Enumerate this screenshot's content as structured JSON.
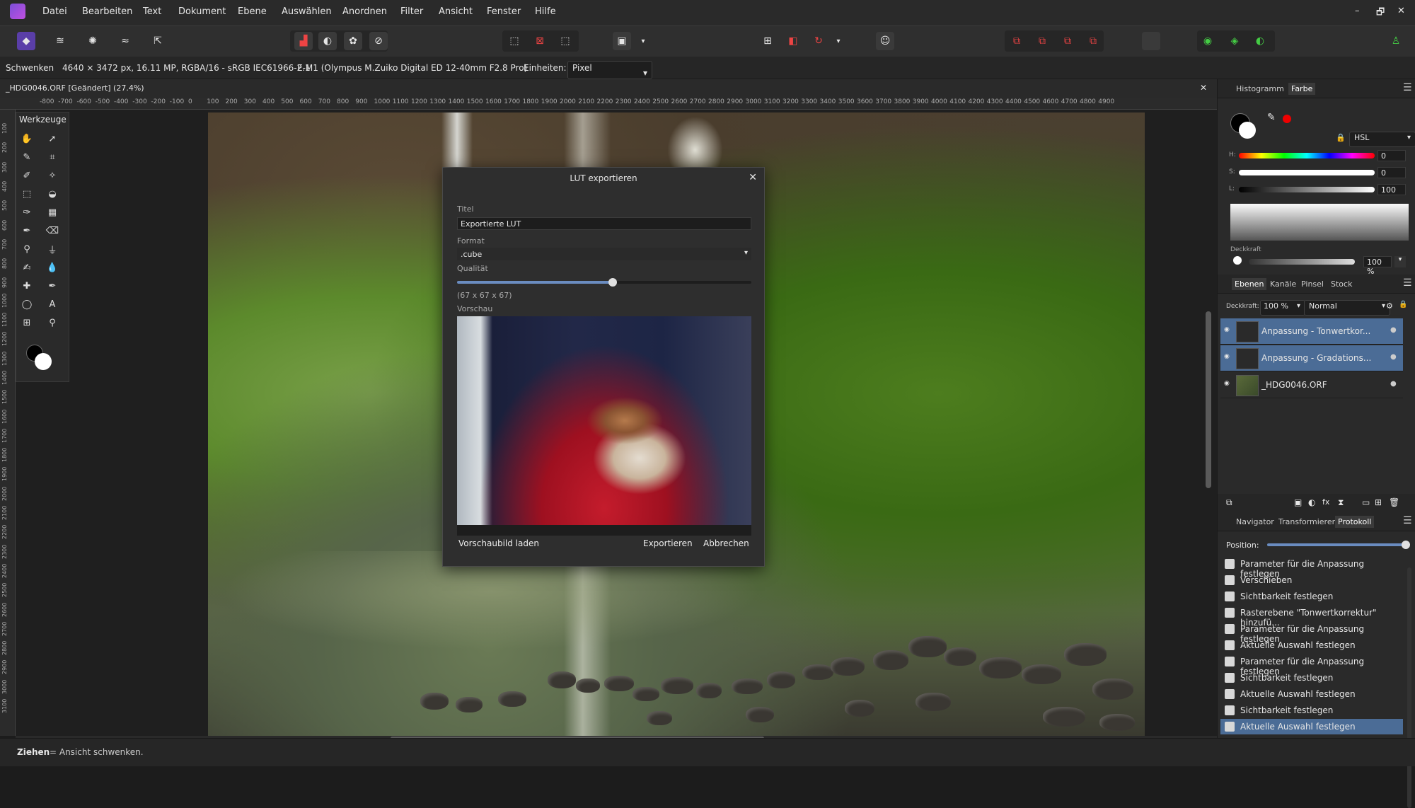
{
  "menu": [
    "Datei",
    "Bearbeiten",
    "Text",
    "Dokument",
    "Ebene",
    "Auswählen",
    "Anordnen",
    "Filter",
    "Ansicht",
    "Fenster",
    "Hilfe"
  ],
  "window_controls": [
    "–",
    "🗗",
    "✕"
  ],
  "context": {
    "tool": "Schwenken",
    "info": "4640 × 3472 px, 16.11 MP, RGBA/16 - sRGB IEC61966-2.1",
    "camera": "E-M1 (Olympus M.Zuiko Digital ED 12-40mm F2.8 Pro)",
    "units_label": "Einheiten:",
    "units_value": "Pixel"
  },
  "document_tab": "_HDG0046.ORF [Geändert] (27.4%)",
  "ruler_top": [
    "-800",
    "-700",
    "-600",
    "-500",
    "-400",
    "-300",
    "-200",
    "-100",
    "0",
    "100",
    "200",
    "300",
    "400",
    "500",
    "600",
    "700",
    "800",
    "900",
    "1000",
    "1100",
    "1200",
    "1300",
    "1400",
    "1500",
    "1600",
    "1700",
    "1800",
    "1900",
    "2000",
    "2100",
    "2200",
    "2300",
    "2400",
    "2500",
    "2600",
    "2700",
    "2800",
    "2900",
    "3000",
    "3100",
    "3200",
    "3300",
    "3400",
    "3500",
    "3600",
    "3700",
    "3800",
    "3900",
    "4000",
    "4100",
    "4200",
    "4300",
    "4400",
    "4500",
    "4600",
    "4700",
    "4800",
    "4900"
  ],
  "ruler_left": [
    "100",
    "200",
    "300",
    "400",
    "500",
    "600",
    "700",
    "800",
    "900",
    "1000",
    "1100",
    "1200",
    "1300",
    "1400",
    "1500",
    "1600",
    "1700",
    "1800",
    "1900",
    "2000",
    "2100",
    "2200",
    "2300",
    "2400",
    "2500",
    "2600",
    "2700",
    "2800",
    "2900",
    "3000",
    "3100"
  ],
  "toolbox": {
    "title": "Werkzeuge"
  },
  "dialog": {
    "title": "LUT exportieren",
    "title_label": "Titel",
    "title_value": "Exportierte LUT",
    "format_label": "Format",
    "format_value": ".cube",
    "quality_label": "Qualität",
    "quality_value": 0.53,
    "quality_info": "(67 x 67 x 67)",
    "preview_label": "Vorschau",
    "load_preview": "Vorschaubild laden",
    "export": "Exportieren",
    "cancel": "Abbrechen"
  },
  "color_panel": {
    "tabs": [
      "Histogramm",
      "Farbe"
    ],
    "mode": "HSL",
    "h_label": "H:",
    "h_value": "0",
    "s_label": "S:",
    "s_value": "0",
    "l_label": "L:",
    "l_value": "100",
    "opacity_label": "Deckkraft",
    "opacity_value": "100 %"
  },
  "layers_panel": {
    "tabs": [
      "Ebenen",
      "Kanäle",
      "Pinsel",
      "Stock"
    ],
    "opacity_label": "Deckkraft:",
    "opacity_value": "100 %",
    "blend_mode": "Normal",
    "layers": [
      {
        "name": "Anpassung - Tonwertkor...",
        "selected": true
      },
      {
        "name": "Anpassung - Gradations...",
        "selected": true
      },
      {
        "name": "_HDG0046.ORF",
        "selected": false
      }
    ]
  },
  "history_panel": {
    "tabs": [
      "Navigator",
      "Transformieren",
      "Protokoll"
    ],
    "position_label": "Position:",
    "position_value": 1.0,
    "items": [
      "Parameter für die Anpassung festlegen",
      "Verschieben",
      "Sichtbarkeit festlegen",
      "Rasterebene \"Tonwertkorrektur\" hinzufü...",
      "Parameter für die Anpassung festlegen",
      "Aktuelle Auswahl festlegen",
      "Parameter für die Anpassung festlegen",
      "Sichtbarkeit festlegen",
      "Aktuelle Auswahl festlegen",
      "Sichtbarkeit festlegen",
      "Aktuelle Auswahl festlegen"
    ],
    "selected_index": 10
  },
  "status": {
    "bold": "Ziehen",
    "text": " = Ansicht schwenken."
  },
  "colors": {
    "accent": "#4b6c96",
    "panel": "#2a2a2a",
    "background": "#1c1c1c"
  }
}
